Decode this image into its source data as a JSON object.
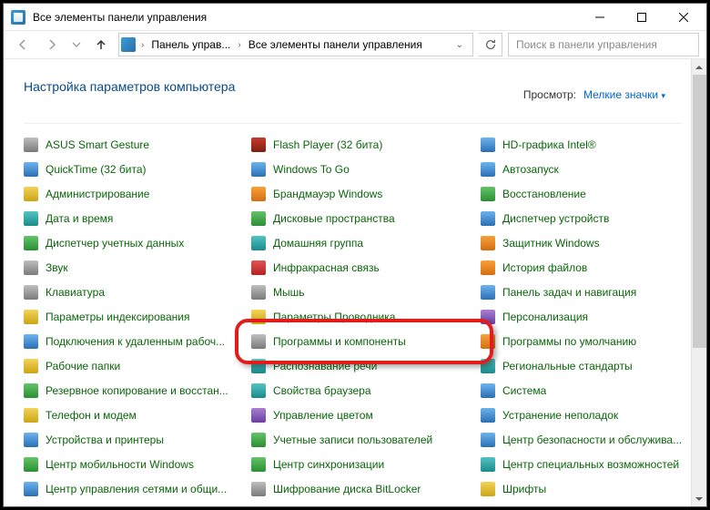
{
  "window": {
    "title": "Все элементы панели управления"
  },
  "nav": {
    "crumb1": "Панель управ...",
    "crumb2": "Все элементы панели управления",
    "search_placeholder": "Поиск в панели управления"
  },
  "main": {
    "heading": "Настройка параметров компьютера",
    "view_label": "Просмотр:",
    "view_value": "Мелкие значки"
  },
  "items": [
    {
      "label": "ASUS Smart Gesture",
      "col": 1,
      "ic": "ic-gray"
    },
    {
      "label": "Flash Player (32 бита)",
      "col": 2,
      "ic": "ic-darkred"
    },
    {
      "label": "HD-графика Intel®",
      "col": 3,
      "ic": "ic-blue"
    },
    {
      "label": "QuickTime (32 бита)",
      "col": 1,
      "ic": "ic-blue"
    },
    {
      "label": "Windows To Go",
      "col": 2,
      "ic": "ic-blue"
    },
    {
      "label": "Автозапуск",
      "col": 3,
      "ic": "ic-blue"
    },
    {
      "label": "Администрирование",
      "col": 1,
      "ic": "ic-yellow"
    },
    {
      "label": "Брандмауэр Windows",
      "col": 2,
      "ic": "ic-orange"
    },
    {
      "label": "Восстановление",
      "col": 3,
      "ic": "ic-green"
    },
    {
      "label": "Дата и время",
      "col": 1,
      "ic": "ic-teal"
    },
    {
      "label": "Дисковые пространства",
      "col": 2,
      "ic": "ic-green"
    },
    {
      "label": "Диспетчер устройств",
      "col": 3,
      "ic": "ic-blue"
    },
    {
      "label": "Диспетчер учетных данных",
      "col": 1,
      "ic": "ic-green"
    },
    {
      "label": "Домашняя группа",
      "col": 2,
      "ic": "ic-teal"
    },
    {
      "label": "Защитник Windows",
      "col": 3,
      "ic": "ic-orange"
    },
    {
      "label": "Звук",
      "col": 1,
      "ic": "ic-gray"
    },
    {
      "label": "Инфракрасная связь",
      "col": 2,
      "ic": "ic-red"
    },
    {
      "label": "История файлов",
      "col": 3,
      "ic": "ic-orange"
    },
    {
      "label": "Клавиатура",
      "col": 1,
      "ic": "ic-gray"
    },
    {
      "label": "Мышь",
      "col": 2,
      "ic": "ic-gray"
    },
    {
      "label": "Панель задач и навигация",
      "col": 3,
      "ic": "ic-blue"
    },
    {
      "label": "Параметры индексирования",
      "col": 1,
      "ic": "ic-yellow"
    },
    {
      "label": "Параметры Проводника",
      "col": 2,
      "ic": "ic-yellow"
    },
    {
      "label": "Персонализация",
      "col": 3,
      "ic": "ic-purple"
    },
    {
      "label": "Подключения к удаленным рабоч...",
      "col": 1,
      "ic": "ic-blue"
    },
    {
      "label": "Программы и компоненты",
      "col": 2,
      "ic": "ic-gray",
      "highlight": true
    },
    {
      "label": "Программы по умолчанию",
      "col": 3,
      "ic": "ic-orange"
    },
    {
      "label": "Рабочие папки",
      "col": 1,
      "ic": "ic-yellow"
    },
    {
      "label": "Распознавание речи",
      "col": 2,
      "ic": "ic-teal"
    },
    {
      "label": "Региональные стандарты",
      "col": 3,
      "ic": "ic-teal"
    },
    {
      "label": "Резервное копирование и восстан...",
      "col": 1,
      "ic": "ic-green"
    },
    {
      "label": "Свойства браузера",
      "col": 2,
      "ic": "ic-teal"
    },
    {
      "label": "Система",
      "col": 3,
      "ic": "ic-blue"
    },
    {
      "label": "Телефон и модем",
      "col": 1,
      "ic": "ic-yellow"
    },
    {
      "label": "Управление цветом",
      "col": 2,
      "ic": "ic-purple"
    },
    {
      "label": "Устранение неполадок",
      "col": 3,
      "ic": "ic-blue"
    },
    {
      "label": "Устройства и принтеры",
      "col": 1,
      "ic": "ic-blue"
    },
    {
      "label": "Учетные записи пользователей",
      "col": 2,
      "ic": "ic-green"
    },
    {
      "label": "Центр безопасности и обслужива...",
      "col": 3,
      "ic": "ic-blue"
    },
    {
      "label": "Центр мобильности Windows",
      "col": 1,
      "ic": "ic-green"
    },
    {
      "label": "Центр синхронизации",
      "col": 2,
      "ic": "ic-green"
    },
    {
      "label": "Центр специальных возможностей",
      "col": 3,
      "ic": "ic-teal"
    },
    {
      "label": "Центр управления сетями и общи...",
      "col": 1,
      "ic": "ic-blue"
    },
    {
      "label": "Шифрование диска BitLocker",
      "col": 2,
      "ic": "ic-gray"
    },
    {
      "label": "Шрифты",
      "col": 3,
      "ic": "ic-yellow"
    }
  ]
}
